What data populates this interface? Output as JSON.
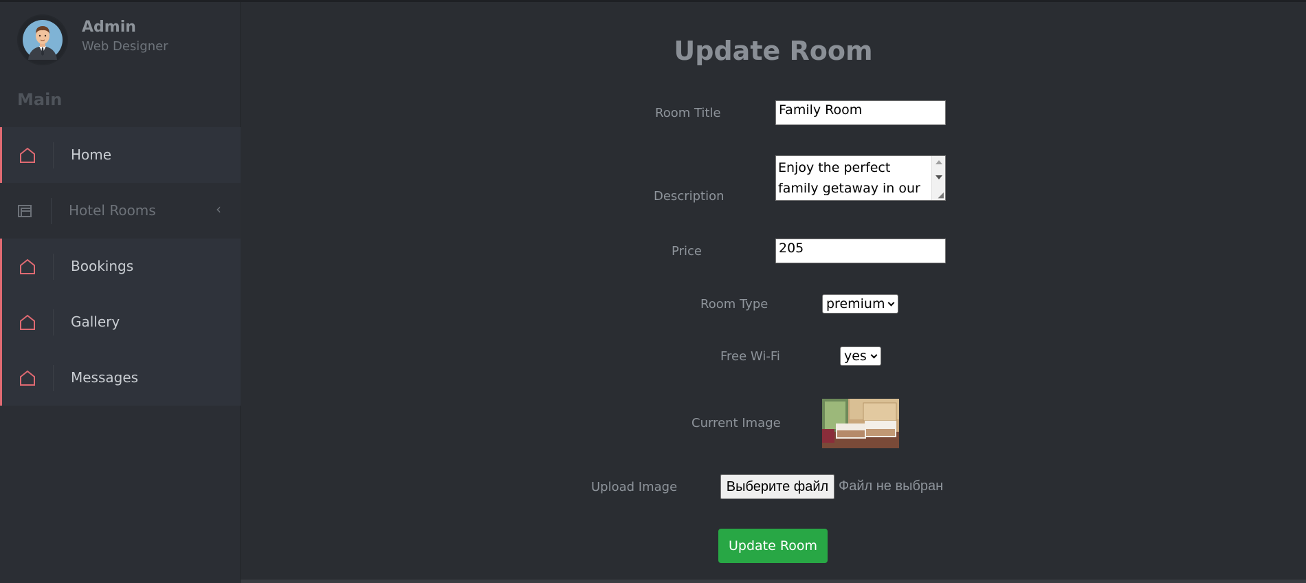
{
  "profile": {
    "name": "Admin",
    "role": "Web Designer",
    "avatar_icon": "user-avatar-icon"
  },
  "sidebar": {
    "section_label": "Main",
    "items": [
      {
        "label": "Home",
        "icon": "home-icon"
      },
      {
        "label": "Hotel Rooms",
        "icon": "rooms-icon",
        "chevron": "‹"
      },
      {
        "label": "Bookings",
        "icon": "home-icon"
      },
      {
        "label": "Gallery",
        "icon": "home-icon"
      },
      {
        "label": "Messages",
        "icon": "home-icon"
      }
    ]
  },
  "form": {
    "title": "Update Room",
    "room_title_label": "Room Title",
    "room_title_value": "Family Room",
    "description_label": "Description",
    "description_value": "Enjoy the perfect family getaway in our",
    "price_label": "Price",
    "price_value": "205",
    "room_type_label": "Room Type",
    "room_type_value": "premium",
    "wifi_label": "Free Wi-Fi",
    "wifi_value": "yes",
    "current_image_label": "Current Image",
    "upload_label": "Upload Image",
    "file_button_label": "Выберите файл",
    "file_status": "Файл не выбран",
    "submit_label": "Update Room"
  },
  "colors": {
    "accent": "#e06a72",
    "submit": "#28a745",
    "background": "#2a2d32"
  }
}
